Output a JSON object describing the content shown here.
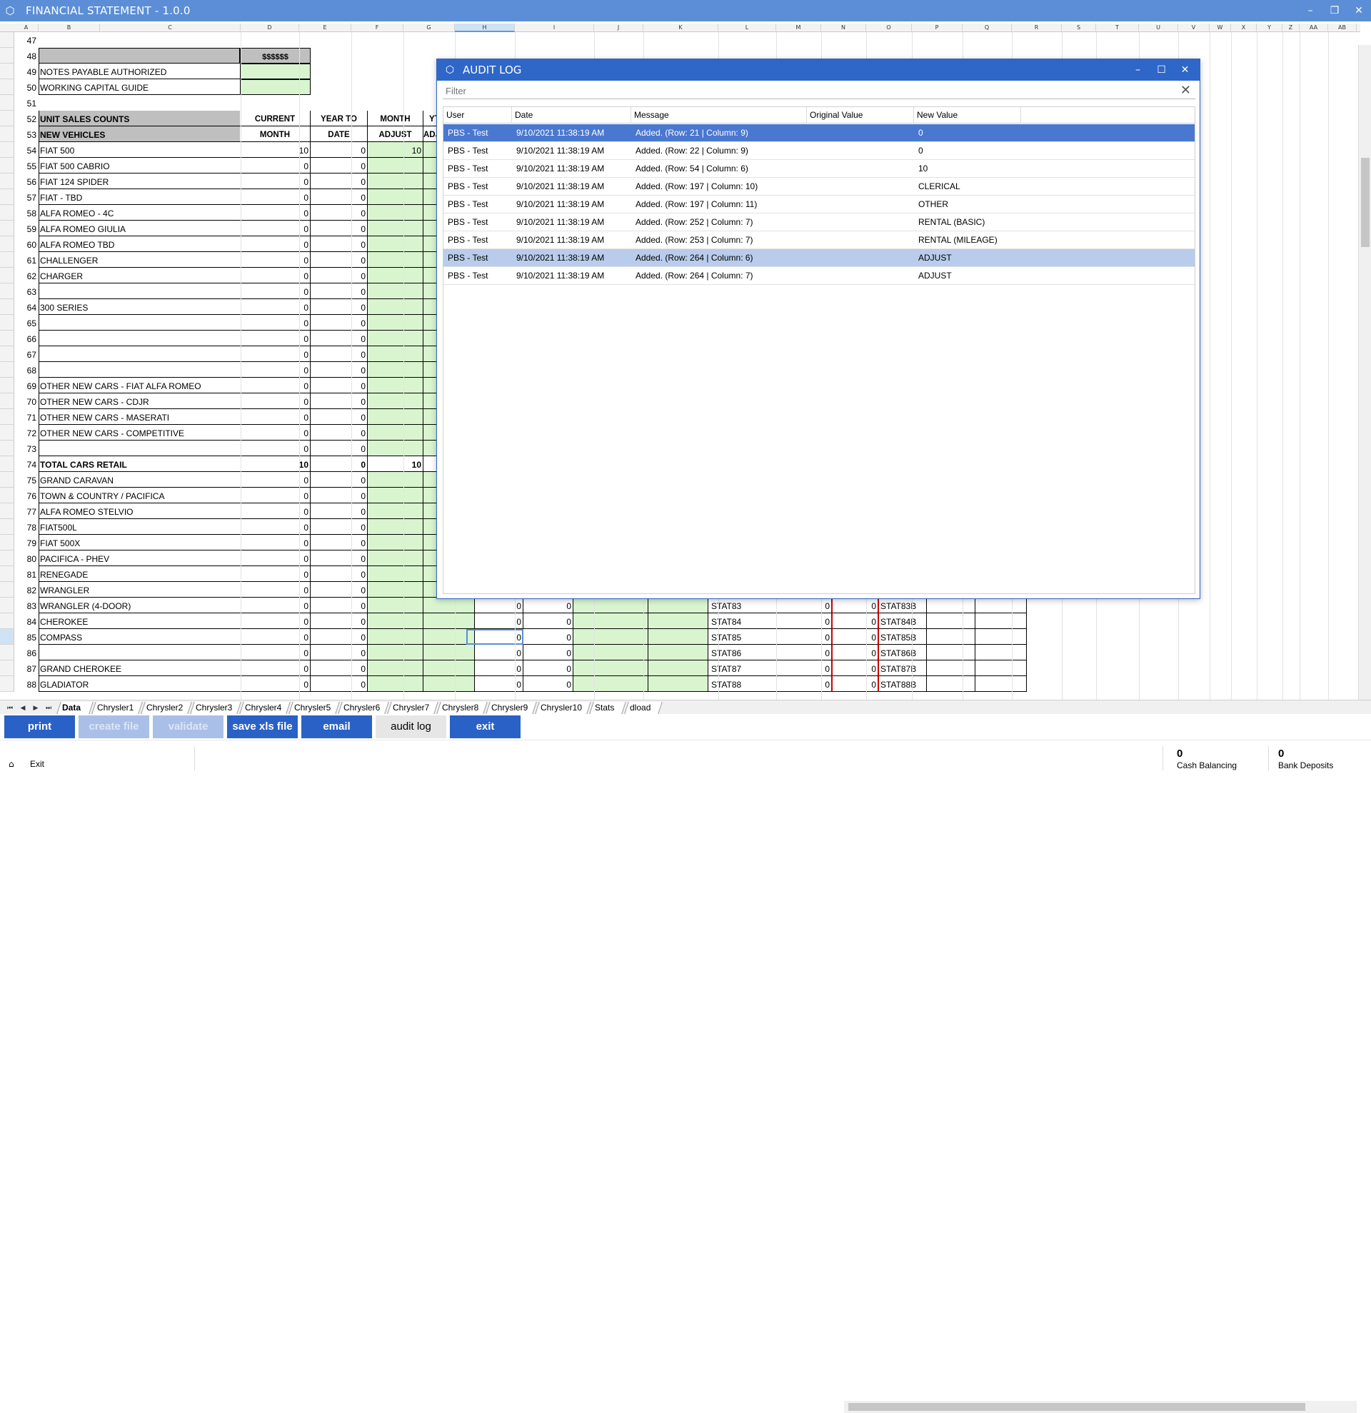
{
  "window": {
    "title": "FINANCIAL STATEMENT - 1.0.0"
  },
  "columns": [
    "A",
    "B",
    "C",
    "D",
    "E",
    "F",
    "G",
    "H",
    "I",
    "J",
    "K",
    "L",
    "M",
    "N",
    "O",
    "P",
    "Q",
    "R",
    "S",
    "T",
    "U",
    "V",
    "W",
    "X",
    "Y",
    "Z",
    "AA",
    "AB"
  ],
  "sheet": {
    "row47": "47",
    "row48": "48",
    "header_dollars": "$$$$$$",
    "row49": {
      "n": "49",
      "label": "NOTES PAYABLE AUTHORIZED"
    },
    "row50": {
      "n": "50",
      "label": "WORKING CAPITAL GUIDE"
    },
    "row51": "51",
    "row52": {
      "n": "52",
      "label": "UNIT SALES COUNTS",
      "c1": "CURRENT",
      "c2": "YEAR TO",
      "c3": "MONTH",
      "c4": "YTD"
    },
    "row53": {
      "n": "53",
      "label": "NEW VEHICLES",
      "c1": "MONTH",
      "c2": "DATE",
      "c3": "ADJUST",
      "c4": "ADJUS"
    },
    "rows": [
      {
        "n": "54",
        "label": "FIAT 500",
        "cur": "10",
        "ytd": "0",
        "adj": "10"
      },
      {
        "n": "55",
        "label": "FIAT 500 CABRIO",
        "cur": "0",
        "ytd": "0",
        "adj": ""
      },
      {
        "n": "56",
        "label": "FIAT 124 SPIDER",
        "cur": "0",
        "ytd": "0",
        "adj": ""
      },
      {
        "n": "57",
        "label": "FIAT - TBD",
        "cur": "0",
        "ytd": "0",
        "adj": ""
      },
      {
        "n": "58",
        "label": "ALFA ROMEO - 4C",
        "cur": "0",
        "ytd": "0",
        "adj": ""
      },
      {
        "n": "59",
        "label": "ALFA ROMEO GIULIA",
        "cur": "0",
        "ytd": "0",
        "adj": ""
      },
      {
        "n": "60",
        "label": "ALFA ROMEO TBD",
        "cur": "0",
        "ytd": "0",
        "adj": ""
      },
      {
        "n": "61",
        "label": "CHALLENGER",
        "cur": "0",
        "ytd": "0",
        "adj": ""
      },
      {
        "n": "62",
        "label": "CHARGER",
        "cur": "0",
        "ytd": "0",
        "adj": ""
      },
      {
        "n": "63",
        "label": "",
        "cur": "0",
        "ytd": "0",
        "adj": ""
      },
      {
        "n": "64",
        "label": "300 SERIES",
        "cur": "0",
        "ytd": "0",
        "adj": ""
      },
      {
        "n": "65",
        "label": "",
        "cur": "0",
        "ytd": "0",
        "adj": ""
      },
      {
        "n": "66",
        "label": "",
        "cur": "0",
        "ytd": "0",
        "adj": ""
      },
      {
        "n": "67",
        "label": "",
        "cur": "0",
        "ytd": "0",
        "adj": ""
      },
      {
        "n": "68",
        "label": "",
        "cur": "0",
        "ytd": "0",
        "adj": ""
      },
      {
        "n": "69",
        "label": "OTHER NEW CARS - FIAT ALFA ROMEO",
        "cur": "0",
        "ytd": "0",
        "adj": ""
      },
      {
        "n": "70",
        "label": "OTHER NEW CARS - CDJR",
        "cur": "0",
        "ytd": "0",
        "adj": ""
      },
      {
        "n": "71",
        "label": "OTHER NEW CARS - MASERATI",
        "cur": "0",
        "ytd": "0",
        "adj": ""
      },
      {
        "n": "72",
        "label": "OTHER NEW CARS - COMPETITIVE",
        "cur": "0",
        "ytd": "0",
        "adj": ""
      },
      {
        "n": "73",
        "label": "",
        "cur": "0",
        "ytd": "0",
        "adj": ""
      },
      {
        "n": "74",
        "label": "TOTAL CARS RETAIL",
        "cur": "10",
        "ytd": "0",
        "adj": "10"
      },
      {
        "n": "75",
        "label": "GRAND CARAVAN",
        "cur": "0",
        "ytd": "0",
        "adj": ""
      },
      {
        "n": "76",
        "label": "TOWN & COUNTRY / PACIFICA",
        "cur": "0",
        "ytd": "0",
        "adj": ""
      },
      {
        "n": "77",
        "label": "ALFA ROMEO STELVIO",
        "cur": "0",
        "ytd": "0",
        "adj": ""
      },
      {
        "n": "78",
        "label": "FIAT500L",
        "cur": "0",
        "ytd": "0",
        "adj": ""
      },
      {
        "n": "79",
        "label": "FIAT 500X",
        "cur": "0",
        "ytd": "0",
        "adj": ""
      },
      {
        "n": "80",
        "label": "PACIFICA - PHEV",
        "cur": "0",
        "ytd": "0",
        "adj": ""
      },
      {
        "n": "81",
        "label": "RENEGADE",
        "cur": "0",
        "ytd": "0",
        "adj": ""
      },
      {
        "n": "82",
        "label": "WRANGLER",
        "cur": "0",
        "ytd": "0",
        "adj": ""
      },
      {
        "n": "83",
        "label": "WRANGLER (4-DOOR)",
        "cur": "0",
        "ytd": "0",
        "adj": "",
        "h": "0",
        "i": "0",
        "stat": "STAT83",
        "m": "0",
        "n2": "0",
        "statb": "STAT83B"
      },
      {
        "n": "84",
        "label": "CHEROKEE",
        "cur": "0",
        "ytd": "0",
        "adj": "",
        "h": "0",
        "i": "0",
        "stat": "STAT84",
        "m": "0",
        "n2": "0",
        "statb": "STAT84B"
      },
      {
        "n": "85",
        "label": "COMPASS",
        "cur": "0",
        "ytd": "0",
        "adj": "",
        "h": "0",
        "i": "0",
        "stat": "STAT85",
        "m": "0",
        "n2": "0",
        "statb": "STAT85B"
      },
      {
        "n": "86",
        "label": "",
        "cur": "0",
        "ytd": "0",
        "adj": "",
        "h": "0",
        "i": "0",
        "stat": "STAT86",
        "m": "0",
        "n2": "0",
        "statb": "STAT86B"
      },
      {
        "n": "87",
        "label": "GRAND CHEROKEE",
        "cur": "0",
        "ytd": "0",
        "adj": "",
        "h": "0",
        "i": "0",
        "stat": "STAT87",
        "m": "0",
        "n2": "0",
        "statb": "STAT87B"
      },
      {
        "n": "88",
        "label": "GLADIATOR",
        "cur": "0",
        "ytd": "0",
        "adj": "",
        "h": "0",
        "i": "0",
        "stat": "STAT88",
        "m": "0",
        "n2": "0",
        "statb": "STAT88B"
      }
    ]
  },
  "sheet_tabs": [
    "Data",
    "Chrysler1",
    "Chrysler2",
    "Chrysler3",
    "Chrysler4",
    "Chrysler5",
    "Chrysler6",
    "Chrysler7",
    "Chrysler8",
    "Chrysler9",
    "Chrysler10",
    "Stats",
    "dload"
  ],
  "buttons": {
    "print": "print",
    "create_file": "create file",
    "validate": "validate",
    "save_xls": "save xls file",
    "email": "email",
    "audit_log": "audit log",
    "exit": "exit"
  },
  "status": {
    "exit_label": "Exit",
    "cash_value": "0",
    "cash_label": "Cash Balancing",
    "bank_value": "0",
    "bank_label": "Bank Deposits"
  },
  "dialog": {
    "title": "AUDIT LOG",
    "filter_placeholder": "Filter",
    "columns": [
      "User",
      "Date",
      "Message",
      "Original Value",
      "New Value"
    ],
    "rows": [
      {
        "user": "PBS - Test",
        "date": "9/10/2021 11:38:19 AM",
        "message": "Added. (Row: 21 | Column: 9)",
        "orig": "",
        "new": "0"
      },
      {
        "user": "PBS - Test",
        "date": "9/10/2021 11:38:19 AM",
        "message": "Added. (Row: 22 | Column: 9)",
        "orig": "",
        "new": "0"
      },
      {
        "user": "PBS - Test",
        "date": "9/10/2021 11:38:19 AM",
        "message": "Added. (Row: 54 | Column: 6)",
        "orig": "",
        "new": "10"
      },
      {
        "user": "PBS - Test",
        "date": "9/10/2021 11:38:19 AM",
        "message": "Added. (Row: 197 | Column: 10)",
        "orig": "",
        "new": "CLERICAL"
      },
      {
        "user": "PBS - Test",
        "date": "9/10/2021 11:38:19 AM",
        "message": "Added. (Row: 197 | Column: 11)",
        "orig": "",
        "new": "OTHER"
      },
      {
        "user": "PBS - Test",
        "date": "9/10/2021 11:38:19 AM",
        "message": "Added. (Row: 252 | Column: 7)",
        "orig": "",
        "new": "RENTAL (BASIC)"
      },
      {
        "user": "PBS - Test",
        "date": "9/10/2021 11:38:19 AM",
        "message": "Added. (Row: 253 | Column: 7)",
        "orig": "",
        "new": "RENTAL (MILEAGE)"
      },
      {
        "user": "PBS - Test",
        "date": "9/10/2021 11:38:19 AM",
        "message": "Added. (Row: 264 | Column: 6)",
        "orig": "",
        "new": "ADJUST"
      },
      {
        "user": "PBS - Test",
        "date": "9/10/2021 11:38:19 AM",
        "message": "Added. (Row: 264 | Column: 7)",
        "orig": "",
        "new": "ADJUST"
      }
    ]
  },
  "colors": {
    "titlebar": "#5b8ed6",
    "dialog_titlebar": "#2e67c8",
    "button_blue": "#2961c6",
    "cell_green": "#d9f5cf",
    "row_selected": "#4a78d0",
    "row_selected_light": "#b9cceb"
  }
}
